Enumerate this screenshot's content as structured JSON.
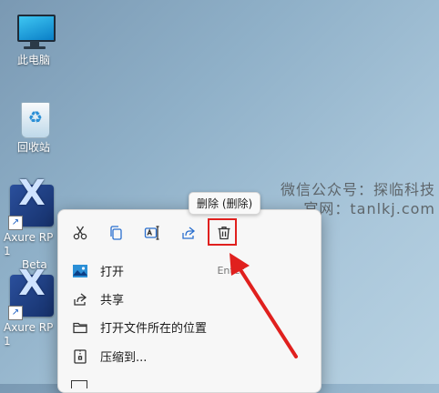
{
  "desktop": {
    "icons": [
      {
        "label": "此电脑",
        "icon": "computer-icon"
      },
      {
        "label": "回收站",
        "icon": "recycle-bin-icon"
      },
      {
        "label": "Axure RP 1",
        "label2": "Beta",
        "icon": "axure-icon"
      },
      {
        "label": "Axure RP 1",
        "icon": "axure-icon"
      }
    ]
  },
  "watermark": {
    "line1": "微信公众号：探临科技",
    "line2": "官网：tanlkj.com"
  },
  "tooltip": {
    "text": "删除 (删除)"
  },
  "context_menu": {
    "toolbar": [
      {
        "name": "cut",
        "icon": "scissors-icon"
      },
      {
        "name": "copy",
        "icon": "copy-icon"
      },
      {
        "name": "rename",
        "icon": "rename-icon"
      },
      {
        "name": "share",
        "icon": "share-icon"
      },
      {
        "name": "delete",
        "icon": "trash-icon"
      }
    ],
    "items": [
      {
        "label": "打开",
        "shortcut": "Enter",
        "icon": "app-icon"
      },
      {
        "label": "共享",
        "shortcut": "",
        "icon": "share-icon"
      },
      {
        "label": "打开文件所在的位置",
        "shortcut": "",
        "icon": "folder-icon"
      },
      {
        "label": "压缩到...",
        "shortcut": "",
        "icon": "archive-icon"
      }
    ]
  },
  "colors": {
    "highlight": "#e0201e",
    "arrow": "#e0201e"
  }
}
